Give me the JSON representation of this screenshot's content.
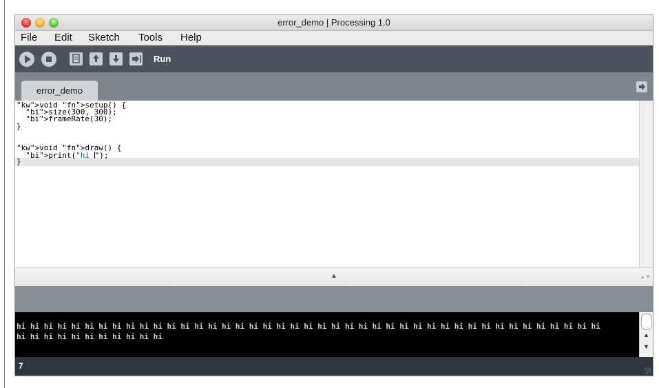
{
  "window": {
    "title": "error_demo | Processing 1.0"
  },
  "menu": {
    "items": [
      "File",
      "Edit",
      "Sketch",
      "Tools",
      "Help"
    ]
  },
  "toolbar": {
    "buttons": [
      "run-icon",
      "stop-icon",
      "new-icon",
      "open-icon",
      "save-icon",
      "export-icon"
    ],
    "hover_label": "Run"
  },
  "tabs": [
    {
      "label": "error_demo"
    }
  ],
  "editor": {
    "lines": [
      "void setup() {",
      "  size(300, 300);",
      "  frameRate(30);",
      "}",
      "",
      "void draw() {",
      "  print(\"hi \");",
      "}"
    ]
  },
  "console": {
    "lines": [
      "hi hi hi hi hi hi hi hi hi hi hi hi hi hi hi hi hi hi hi hi hi hi hi hi hi hi hi hi hi hi hi hi hi hi hi hi hi hi hi hi hi hi hi",
      "hi hi hi hi hi hi hi hi hi hi hi"
    ]
  },
  "status": {
    "line_number": "7"
  },
  "colors": {
    "toolbar": "#4b545d",
    "tabstrip": "#7e868e",
    "console_bg": "#000000",
    "keyword": "#cc6600",
    "builtin": "#006699"
  }
}
